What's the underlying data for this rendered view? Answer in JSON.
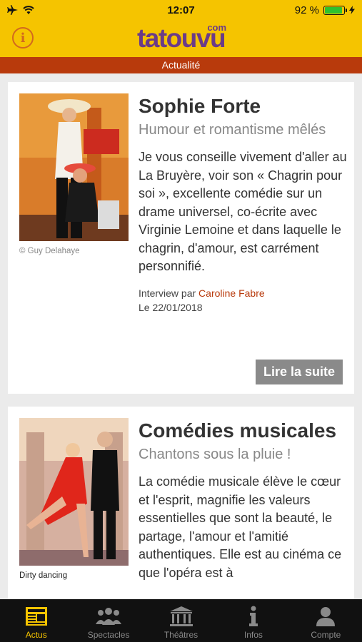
{
  "status_bar": {
    "time": "12:07",
    "battery": "92 %",
    "battery_level": 0.92
  },
  "header": {
    "logo": "tatouvu",
    "logo_suffix": "com",
    "info_glyph": "i"
  },
  "section": {
    "title": "Actualité"
  },
  "articles": [
    {
      "title": "Sophie Forte",
      "subtitle": "Humour et romantisme mêlés",
      "excerpt": "Je vous conseille vivement d'aller au La Bruyère, voir son « Chagrin pour soi », excellente comédie sur un drame universel, co-écrite avec Virginie Lemoine et dans laquelle le chagrin, d'amour, est carrément personnifié.",
      "photo_credit": "© Guy Delahaye",
      "author_prefix": "Interview par",
      "author": "Caroline Fabre",
      "date": "Le 22/01/2018",
      "read_more": "Lire la suite"
    },
    {
      "title": "Comédies musicales",
      "subtitle": "Chantons sous la pluie !",
      "excerpt": "La comédie musicale élève le cœur et l'esprit, magnifie les valeurs essentielles que sont la beauté, le partage, l'amour et l'amitié authentiques. Elle est au cinéma ce que l'opéra est à",
      "photo_credit": "Dirty dancing"
    }
  ],
  "tabs": [
    {
      "label": "Actus",
      "icon": "newspaper-icon",
      "active": true
    },
    {
      "label": "Spectacles",
      "icon": "audience-icon",
      "active": false
    },
    {
      "label": "Théâtres",
      "icon": "theatre-building-icon",
      "active": false
    },
    {
      "label": "Infos",
      "icon": "info-icon",
      "active": false
    },
    {
      "label": "Compte",
      "icon": "user-icon",
      "active": false
    }
  ],
  "colors": {
    "brand_yellow": "#f5c400",
    "brand_purple": "#6b3b88",
    "accent_red": "#b83a0c",
    "button_grey": "#8a8a8a"
  }
}
